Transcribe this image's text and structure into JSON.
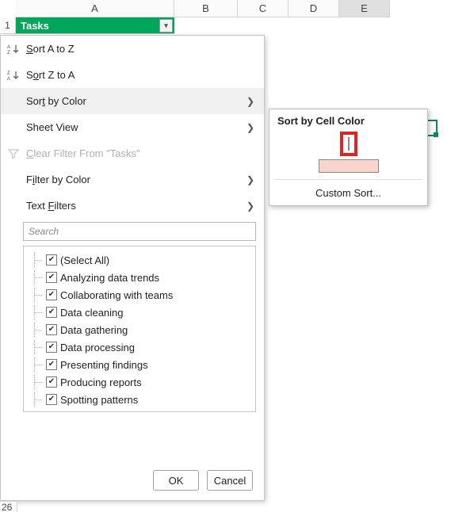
{
  "columns": {
    "A": "A",
    "B": "B",
    "C": "C",
    "D": "D",
    "E": "E"
  },
  "row1_number": "1",
  "row26_number": "26",
  "cellA1": "Tasks",
  "menu": {
    "sort_asc": "Sort A to Z",
    "sort_desc": "Sort Z to A",
    "sort_by_color": "Sort by Color",
    "sheet_view": "Sheet View",
    "clear_filter": "Clear Filter From \"Tasks\"",
    "filter_by_color": "Filter by Color",
    "text_filters": "Text Filters",
    "search_placeholder": "Search",
    "items": [
      "(Select All)",
      "Analyzing data trends",
      "Collaborating with teams",
      "Data cleaning",
      "Data gathering",
      "Data processing",
      "Presenting findings",
      "Producing reports",
      "Spotting patterns"
    ],
    "ok": "OK",
    "cancel": "Cancel"
  },
  "submenu": {
    "title": "Sort by Cell Color",
    "custom_sort": "Custom Sort...",
    "colors": {
      "green": "#c7e9c0",
      "pink": "#f8d4cc"
    }
  }
}
